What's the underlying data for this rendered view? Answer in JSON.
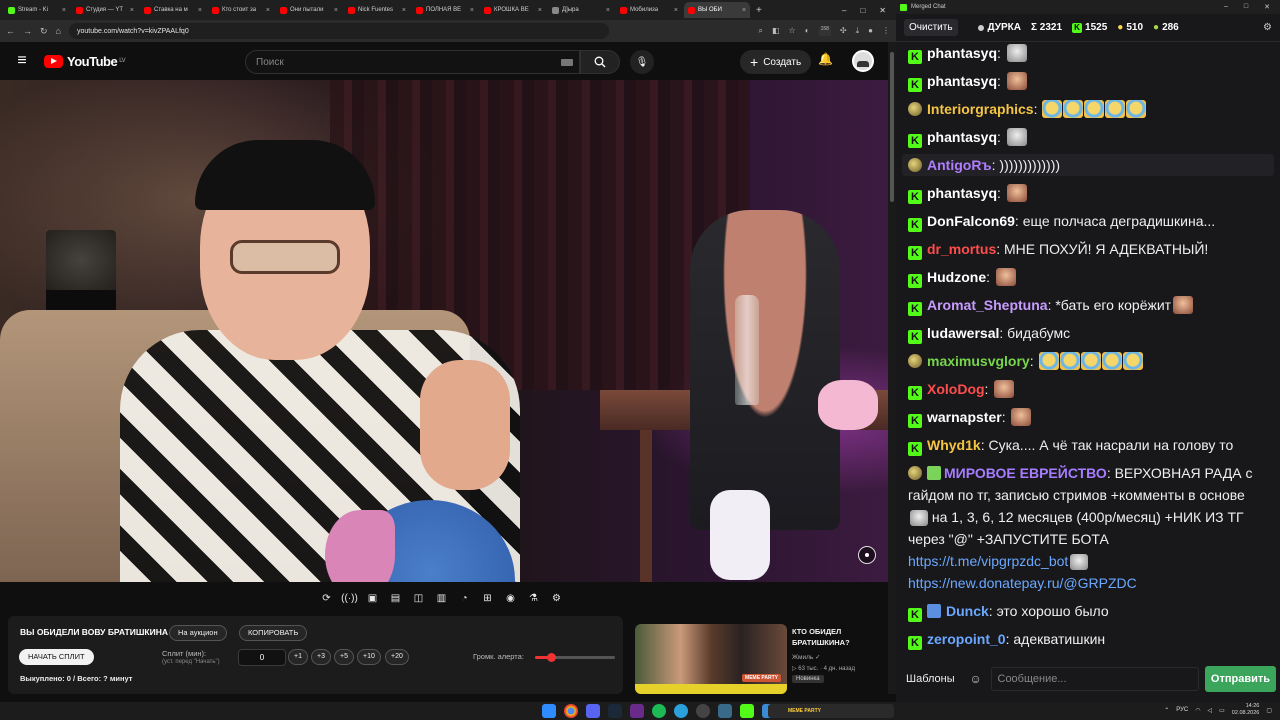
{
  "browser": {
    "tabs": [
      {
        "label": "Stream - Ki",
        "color": "#53fc18",
        "active": false
      },
      {
        "label": "Студия — YT",
        "color": "#ff0000",
        "active": false
      },
      {
        "label": "Ставка на м",
        "color": "#ff0000",
        "active": false
      },
      {
        "label": "Кто стоит за",
        "color": "#ff0000",
        "active": false
      },
      {
        "label": "Они пытали",
        "color": "#ff0000",
        "active": false
      },
      {
        "label": "Nick Fuentes",
        "color": "#ff0000",
        "active": false
      },
      {
        "label": "ПОЛНАЯ ВЕ",
        "color": "#ff0000",
        "active": false
      },
      {
        "label": "КРОШКА ВЕ",
        "color": "#ff0000",
        "active": false
      },
      {
        "label": "Д]ыра",
        "color": "#888888",
        "active": false
      },
      {
        "label": "Мобилиза",
        "color": "#ff0000",
        "active": false
      },
      {
        "label": "ВЫ ОБИ",
        "color": "#ff0000",
        "active": true
      }
    ],
    "url": "youtube.com/watch?v=kivZPAALfq0",
    "extension_badge": "158"
  },
  "youtube": {
    "logo_text": "YouTube",
    "region": "LV",
    "search_placeholder": "Поиск",
    "create_label": "Создать"
  },
  "auction": {
    "title": "ВЫ ОБИДЕЛИ ВОВУ БРАТИШКИНА",
    "to_auction": "На аукцион",
    "copy": "КОПИРОВАТЬ",
    "start_split": "НАЧАТЬ СПЛИТ",
    "split_label": "Сплит (мин):",
    "split_sub": "(уст. перед \"Начать\")",
    "split_value": "0",
    "steps": [
      "+1",
      "+3",
      "+5",
      "+10",
      "+20"
    ],
    "volume_label": "Громк. алерта:",
    "volume_fraction": 0.2,
    "status": "Выкуплено: 0 / Всего: ? минут"
  },
  "recommendation": {
    "title": "КТО ОБИДЕЛ БРАТИШКИНА?",
    "channel": "Жмиль",
    "meta": "▷ 63 тыс. · 4 дн. назад",
    "badge_new": "Новинка",
    "thumb_badge": "MEME PARTY"
  },
  "chat": {
    "window_title": "Merged Chat",
    "clear": "Очистить",
    "channel": "ДУРКА",
    "sum": "Σ 2321",
    "kick_count": "1525",
    "trovo_count": "510",
    "other_count": "286",
    "messages": [
      {
        "badges": [
          "k"
        ],
        "user": "phantasyq",
        "color": "#ffffff",
        "text": "",
        "emotes": [
          "gray"
        ]
      },
      {
        "badges": [
          "k"
        ],
        "user": "phantasyq",
        "color": "#ffffff",
        "text": "",
        "emotes": [
          "face"
        ]
      },
      {
        "badges": [
          "pic"
        ],
        "user": "Interiorgraphics",
        "color": "#f5c542",
        "text": "",
        "emotes": [
          "laugh",
          "laugh",
          "laugh",
          "laugh",
          "laugh"
        ]
      },
      {
        "badges": [
          "k"
        ],
        "user": "phantasyq",
        "color": "#ffffff",
        "text": "",
        "emotes": [
          "gray"
        ]
      },
      {
        "badges": [
          "pic"
        ],
        "user": "AntigoRъ",
        "color": "#b07dff",
        "text": ")))))))))))))",
        "emotes": [],
        "hl": true
      },
      {
        "badges": [
          "k"
        ],
        "user": "phantasyq",
        "color": "#ffffff",
        "text": "",
        "emotes": [
          "face"
        ]
      },
      {
        "badges": [
          "k"
        ],
        "user": "DonFalcon69",
        "color": "#ffffff",
        "text": "еще полчаса деградишкина...",
        "emotes": []
      },
      {
        "badges": [
          "k"
        ],
        "user": "dr_mortus",
        "color": "#ff4d4d",
        "text": "МНЕ ПОХУЙ! Я АДЕКВАТНЫЙ!",
        "emotes": []
      },
      {
        "badges": [
          "k"
        ],
        "user": "Hudzone",
        "color": "#ffffff",
        "text": "",
        "emotes": [
          "face"
        ]
      },
      {
        "badges": [
          "k"
        ],
        "user": "Aromat_Sheptuna",
        "color": "#c89cff",
        "text": "*бать его корёжит",
        "emotes": [
          "face"
        ]
      },
      {
        "badges": [
          "k"
        ],
        "user": "ludawersal",
        "color": "#ffffff",
        "text": "бидабумс",
        "emotes": []
      },
      {
        "badges": [
          "pic"
        ],
        "user": "maximusvglory",
        "color": "#78d64b",
        "text": "",
        "emotes": [
          "laugh",
          "laugh",
          "laugh",
          "laugh",
          "laugh"
        ]
      },
      {
        "badges": [
          "k"
        ],
        "user": "XoloDog",
        "color": "#ff4d4d",
        "text": "",
        "emotes": [
          "face"
        ]
      },
      {
        "badges": [
          "k"
        ],
        "user": "warnapster",
        "color": "#ffffff",
        "text": "",
        "emotes": [
          "face"
        ]
      },
      {
        "badges": [
          "k"
        ],
        "user": "Whyd1k",
        "color": "#f5c542",
        "text": "Сука.... А чё так насрали на голову то",
        "emotes": []
      },
      {
        "badges": [
          "pic",
          "check"
        ],
        "user": "МИРОВОЕ ЕВРЕЙСТВО",
        "color": "#a77dff",
        "text": "ВЕРХОВНАЯ РАДА с гайдом по тг, записью стримов +комменты в основе",
        "text2": "на 1, 3, 6, 12 месяцев (400р/месяц) +НИК ИЗ ТГ через \"@\" +ЗАПУСТИТЕ БОТА",
        "link1": "https://t.me/vipgrpzdc_bot",
        "link2": "https://new.donatepay.ru/@GRPZDC",
        "emotes": []
      },
      {
        "badges": [
          "k",
          "pen"
        ],
        "user": "Dunck",
        "color": "#6ba8ff",
        "text": "это хорошо было",
        "emotes": []
      },
      {
        "badges": [
          "k"
        ],
        "user": "zeropoint_0",
        "color": "#6ba8ff",
        "text": "адекватишкин",
        "emotes": []
      }
    ],
    "templates": "Шаблоны",
    "input_placeholder": "Сообщение...",
    "send": "Отправить"
  },
  "taskbar": {
    "lang": "РУС",
    "time": "14:26",
    "date": "02.08.2026",
    "media_label": "MEME PARTY"
  }
}
